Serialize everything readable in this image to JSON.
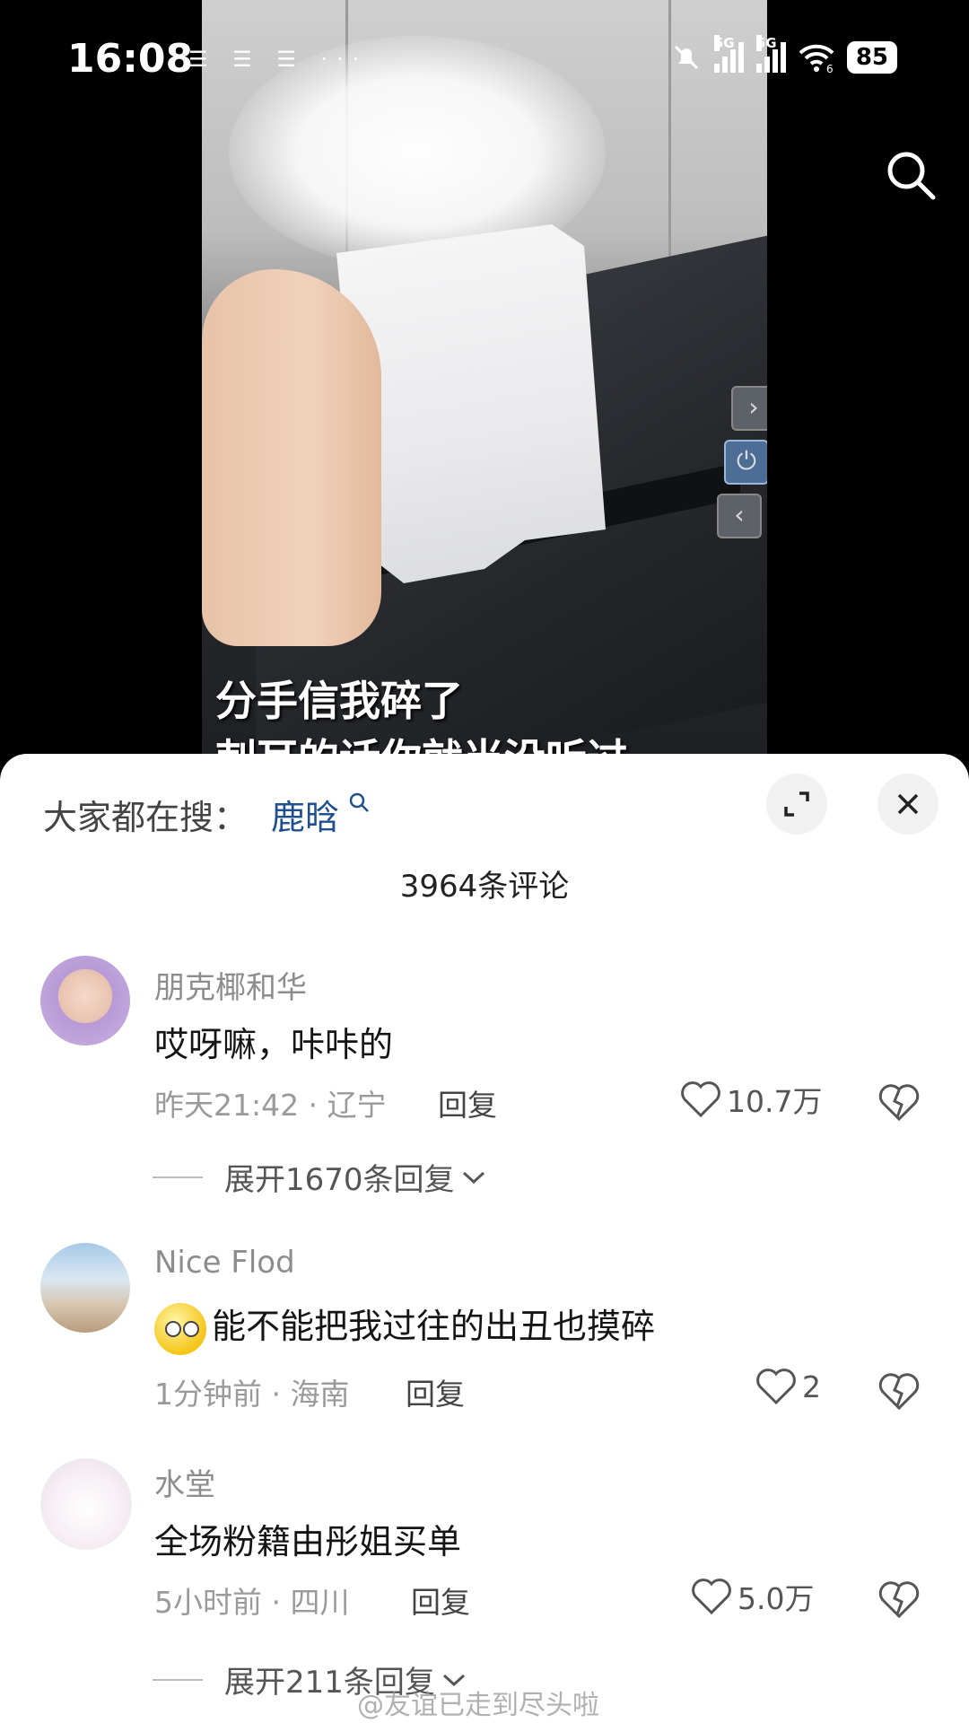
{
  "status_bar": {
    "time": "16:08",
    "notif_icons": "☰ ☰ ☰ ···",
    "network_1": "5G",
    "network_2": "5G",
    "wifi_suffix": "6",
    "battery": "85"
  },
  "video": {
    "caption_line1": "分手信我碎了",
    "caption_line2": "刺耳的话你就当没听过"
  },
  "comments_panel": {
    "trending_prefix": "大家都在搜：",
    "trending_term": "鹿晗",
    "comment_count": "3964条评论",
    "comments": [
      {
        "username": "朋克椰和华",
        "text": "哎呀嘛，咔咔的",
        "time": "昨天21:42",
        "location": "辽宁",
        "reply_label": "回复",
        "likes": "10.7万",
        "expand_replies": "展开1670条回复"
      },
      {
        "username": "Nice Flod",
        "text": "能不能把我过往的出丑也摸碎",
        "time": "1分钟前",
        "location": "海南",
        "reply_label": "回复",
        "likes": "2"
      },
      {
        "username": "水堂",
        "text": "全场粉籍由彤姐买单",
        "time": "5小时前",
        "location": "四川",
        "reply_label": "回复",
        "likes": "5.0万",
        "expand_replies": "展开211条回复"
      }
    ]
  },
  "watermark": "@友谊已走到尽头啦",
  "colors": {
    "trending_term": "#1f4f8f",
    "sheet_bg": "#ffffff",
    "meta_gray": "#9a9a9a"
  }
}
